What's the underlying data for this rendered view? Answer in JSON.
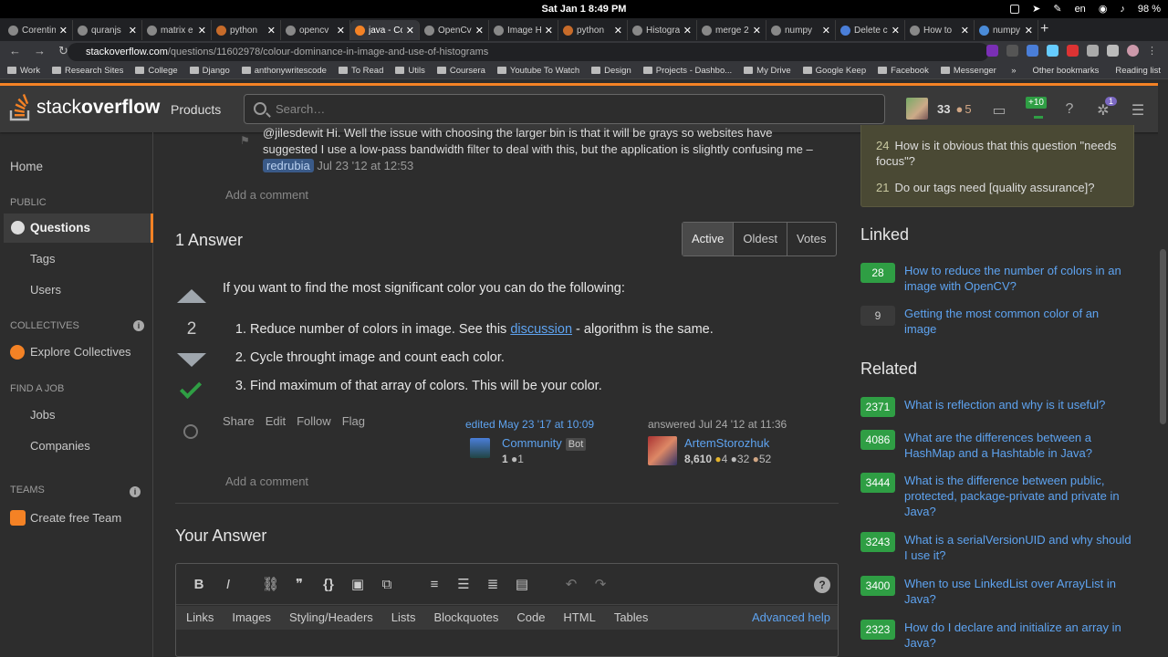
{
  "os_bar": {
    "clock": "Sat Jan 1  8:49 PM",
    "lang": "en",
    "battery": "98 %"
  },
  "browser": {
    "tabs": [
      "Corentin",
      "quranjs",
      "matrix e",
      "python",
      "opencv",
      "java - Co",
      "OpenCv",
      "Image H",
      "python",
      "Histogra",
      "merge 2",
      "numpy",
      "Delete c",
      "How to",
      "numpy"
    ],
    "active_tab_index": 5,
    "url_domain": "stackoverflow.com",
    "url_path": "/questions/11602978/colour-dominance-in-image-and-use-of-histograms",
    "bookmarks": [
      "Work",
      "Research Sites",
      "College",
      "Django",
      "anthonywritescode",
      "To Read",
      "Utils",
      "Coursera",
      "Youtube To Watch",
      "Design",
      "Projects - Dashbo...",
      "My Drive",
      "Google Keep",
      "Facebook",
      "Messenger"
    ],
    "other_bookmarks": "Other bookmarks",
    "reading_list": "Reading list"
  },
  "header": {
    "logo_light": "stack",
    "logo_bold": "overflow",
    "products": "Products",
    "search_placeholder": "Search…",
    "reputation": "33",
    "bronze": "5",
    "rep_change": "+10",
    "achievements_badge": "1"
  },
  "leftnav": {
    "home": "Home",
    "public": "PUBLIC",
    "questions": "Questions",
    "tags": "Tags",
    "users": "Users",
    "collectives": "COLLECTIVES",
    "explore_collectives": "Explore Collectives",
    "find_a_job": "FIND A JOB",
    "jobs": "Jobs",
    "companies": "Companies",
    "teams": "TEAMS",
    "create_team": "Create free Team"
  },
  "main": {
    "comment_text": "@jilesdewit Hi. Well the issue with choosing the larger bin is that it will be grays so websites have suggested I use a low-pass bandwidth filter to deal with this, but the application is slightly confusing me",
    "comment_dash": "–",
    "comment_user": "redrubia",
    "comment_date": "Jul 23 '12 at 12:53",
    "add_comment": "Add a comment",
    "answers_count": "1 Answer",
    "sort_options": [
      "Active",
      "Oldest",
      "Votes"
    ],
    "vote_count": "2",
    "answer_intro": "If you want to find the most significant color you can do the following:",
    "steps": {
      "s1_before": "Reduce number of colors in image. See this ",
      "s1_link": "discussion",
      "s1_after": " - algorithm is the same.",
      "s2": "Cycle throught image and count each color.",
      "s3": "Find maximum of that array of colors. This will be your color."
    },
    "post_menu": [
      "Share",
      "Edit",
      "Follow",
      "Flag"
    ],
    "edited": {
      "label": "edited May 23 '17 at 10:09",
      "name": "Community",
      "bot": "Bot",
      "rep": "1",
      "silver": "1"
    },
    "answered": {
      "label": "answered Jul 24 '12 at 11:36",
      "name": "ArtemStorozhuk",
      "rep": "8,610",
      "gold": "4",
      "silver": "32",
      "bronze": "52"
    },
    "add_comment_2": "Add a comment",
    "your_answer": "Your Answer",
    "help_tabs": [
      "Links",
      "Images",
      "Styling/Headers",
      "Lists",
      "Blockquotes",
      "Code",
      "HTML",
      "Tables"
    ],
    "advanced_help": "Advanced help"
  },
  "sidebar": {
    "meta": [
      {
        "count": "24",
        "text": "How is it obvious that this question \"needs focus\"?"
      },
      {
        "count": "21",
        "text": "Do our tags need [quality assurance]?"
      }
    ],
    "linked_title": "Linked",
    "linked": [
      {
        "score": "28",
        "text": "How to reduce the number of colors in an image with OpenCV?",
        "accepted": true
      },
      {
        "score": "9",
        "text": "Getting the most common color of an image",
        "accepted": false
      }
    ],
    "related_title": "Related",
    "related": [
      {
        "score": "2371",
        "text": "What is reflection and why is it useful?"
      },
      {
        "score": "4086",
        "text": "What are the differences between a HashMap and a Hashtable in Java?"
      },
      {
        "score": "3444",
        "text": "What is the difference between public, protected, package-private and private in Java?"
      },
      {
        "score": "3243",
        "text": "What is a serialVersionUID and why should I use it?"
      },
      {
        "score": "3400",
        "text": "When to use LinkedList over ArrayList in Java?"
      },
      {
        "score": "2323",
        "text": "How do I declare and initialize an array in Java?"
      }
    ]
  },
  "colors": {
    "accent": "#f48225",
    "link": "#5ea3f0",
    "accepted": "#2f9e44"
  }
}
